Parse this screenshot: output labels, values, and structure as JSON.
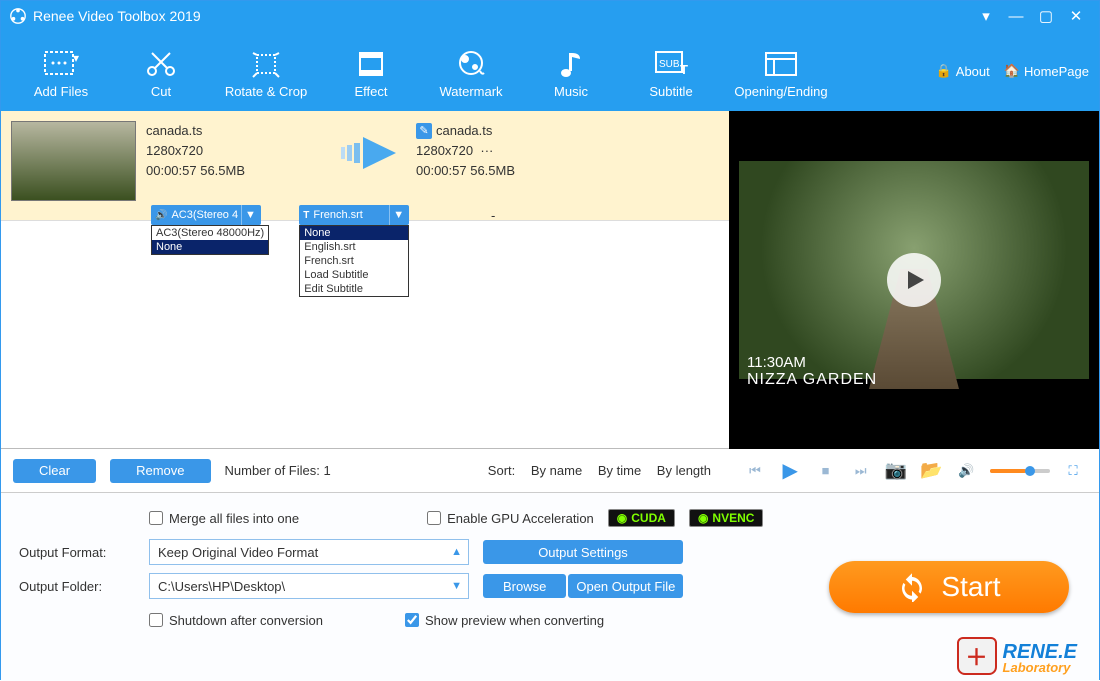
{
  "titlebar": {
    "title": "Renee Video Toolbox 2019"
  },
  "toolbar": {
    "items": [
      {
        "label": "Add Files"
      },
      {
        "label": "Cut"
      },
      {
        "label": "Rotate & Crop"
      },
      {
        "label": "Effect"
      },
      {
        "label": "Watermark"
      },
      {
        "label": "Music"
      },
      {
        "label": "Subtitle"
      },
      {
        "label": "Opening/Ending"
      }
    ],
    "about": "About",
    "homepage": "HomePage"
  },
  "file": {
    "src_name": "canada.ts",
    "src_res": "1280x720",
    "src_meta": "00:00:57  56.5MB",
    "dst_name": "canada.ts",
    "dst_res": "1280x720",
    "dst_dots": "···",
    "dst_meta": "00:00:57  56.5MB",
    "dash": "-"
  },
  "audio_dd": {
    "head": "AC3(Stereo 4",
    "items": [
      "AC3(Stereo 48000Hz)",
      "None"
    ],
    "selectedIndex": 1
  },
  "sub_dd": {
    "head": "French.srt",
    "items": [
      "None",
      "English.srt",
      "French.srt",
      "Load Subtitle",
      "Edit Subtitle"
    ],
    "selectedIndex": 0
  },
  "preview": {
    "time": "11:30AM",
    "place": "NIZZA GARDEN"
  },
  "listfooter": {
    "clear": "Clear",
    "remove": "Remove",
    "count_label": "Number of Files:  1",
    "sort_label": "Sort:",
    "sort_options": [
      "By name",
      "By time",
      "By length"
    ]
  },
  "lower": {
    "merge": "Merge all files into one",
    "gpu": "Enable GPU Acceleration",
    "cuda": "CUDA",
    "nvenc": "NVENC",
    "format_label": "Output Format:",
    "format_value": "Keep Original Video Format",
    "folder_label": "Output Folder:",
    "folder_value": "C:\\Users\\HP\\Desktop\\",
    "output_settings": "Output Settings",
    "browse": "Browse",
    "open_folder": "Open Output File",
    "shutdown": "Shutdown after conversion",
    "show_preview": "Show preview when converting",
    "start": "Start",
    "brand1": "RENE.E",
    "brand2": "Laboratory"
  }
}
